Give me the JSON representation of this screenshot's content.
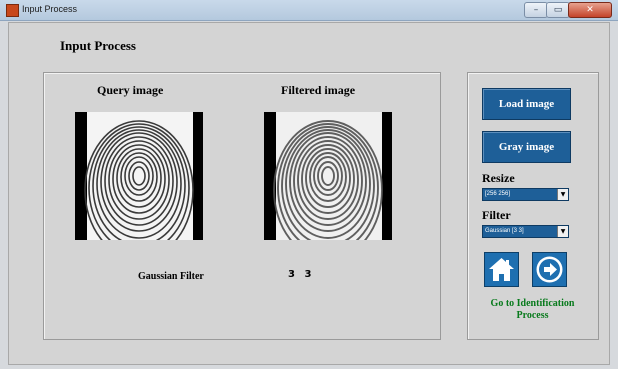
{
  "window": {
    "title": "Input Process",
    "minimize_glyph": "–",
    "maximize_glyph": "▭",
    "close_glyph": "✕"
  },
  "heading": "Input Process",
  "query_panel": {
    "caption": "Query image"
  },
  "filtered_panel": {
    "caption": "Filtered image"
  },
  "filter_info": {
    "name": "Gaussian Filter",
    "kernel_display": "3 3"
  },
  "buttons": {
    "load_label": "Load image",
    "gray_label": "Gray image"
  },
  "resize": {
    "label": "Resize",
    "selected": "[256 256]"
  },
  "filter": {
    "label": "Filter",
    "selected": "Gaussian [3 3]"
  },
  "icons": {
    "home": "home-icon",
    "next": "arrow-right-icon"
  },
  "goto_label_line1": "Go to Identification",
  "goto_label_line2": "Process",
  "colors": {
    "button_blue": "#1e5f98",
    "link_green": "#087a1c"
  }
}
